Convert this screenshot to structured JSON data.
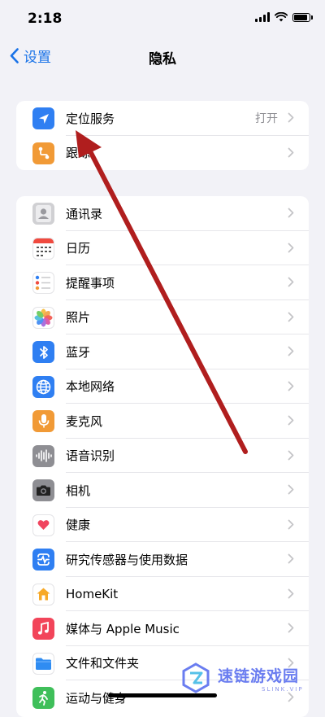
{
  "status": {
    "time": "2:18"
  },
  "nav": {
    "back_label": "设置",
    "title": "隐私"
  },
  "groups": [
    {
      "items": [
        {
          "label": "定位服务",
          "value": "打开",
          "icon": "location-arrow-icon",
          "color": "#2f7ff2"
        },
        {
          "label": "跟踪",
          "value": "",
          "icon": "tracking-icon",
          "color": "#f19a36"
        }
      ]
    },
    {
      "items": [
        {
          "label": "通讯录",
          "icon": "contacts-icon",
          "color": "#c9c9cc"
        },
        {
          "label": "日历",
          "icon": "calendar-icon",
          "color": "#ffffff"
        },
        {
          "label": "提醒事项",
          "icon": "reminders-icon",
          "color": "#ffffff"
        },
        {
          "label": "照片",
          "icon": "photos-icon",
          "color": "#ffffff"
        },
        {
          "label": "蓝牙",
          "icon": "bluetooth-icon",
          "color": "#2f7ff2"
        },
        {
          "label": "本地网络",
          "icon": "globe-icon",
          "color": "#2f7ff2"
        },
        {
          "label": "麦克风",
          "icon": "microphone-icon",
          "color": "#f19a36"
        },
        {
          "label": "语音识别",
          "icon": "waveform-icon",
          "color": "#8e8e93"
        },
        {
          "label": "相机",
          "icon": "camera-icon",
          "color": "#8e8e93"
        },
        {
          "label": "健康",
          "icon": "heart-icon",
          "color": "#ffffff"
        },
        {
          "label": "研究传感器与使用数据",
          "icon": "research-icon",
          "color": "#2f7ff2"
        },
        {
          "label": "HomeKit",
          "icon": "home-icon",
          "color": "#ffffff"
        },
        {
          "label": "媒体与 Apple Music",
          "icon": "music-note-icon",
          "color": "#f2455a"
        },
        {
          "label": "文件和文件夹",
          "icon": "folder-icon",
          "color": "#ffffff"
        },
        {
          "label": "运动与健身",
          "icon": "fitness-icon",
          "color": "#3fbf5a"
        }
      ]
    }
  ],
  "watermark": {
    "title": "速链游戏园",
    "subtitle": "SLINK.VIP"
  },
  "colors": {
    "accent": "#1a73e8",
    "annotation": "#b01e1e",
    "background": "#f2f2f7"
  }
}
